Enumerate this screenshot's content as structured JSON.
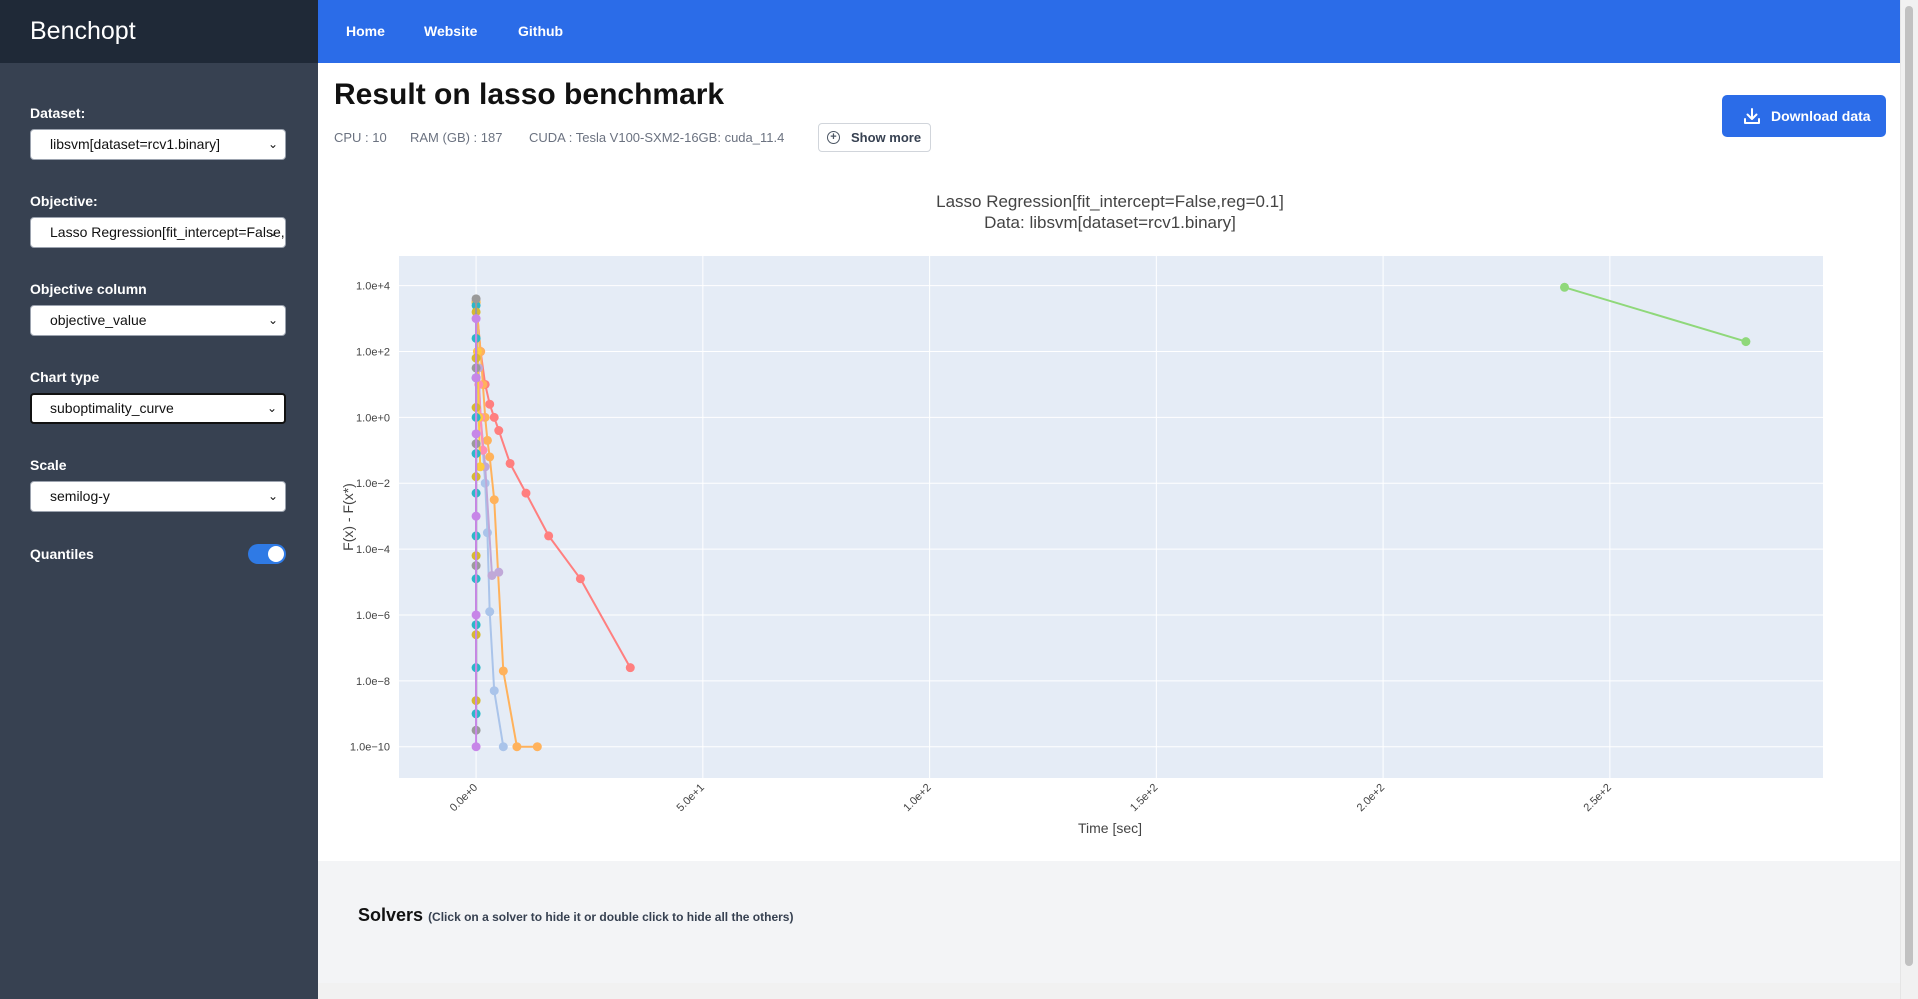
{
  "app": {
    "title": "Benchopt"
  },
  "nav": {
    "home": "Home",
    "website": "Website",
    "github": "Github"
  },
  "sidebar": {
    "dataset": {
      "label": "Dataset:",
      "value": "libsvm[dataset=rcv1.binary]"
    },
    "objective": {
      "label": "Objective:",
      "value": "Lasso Regression[fit_intercept=False,reg=0.1]"
    },
    "objective_column": {
      "label": "Objective column",
      "value": "objective_value"
    },
    "chart_type": {
      "label": "Chart type",
      "value": "suboptimality_curve"
    },
    "scale": {
      "label": "Scale",
      "value": "semilog-y"
    },
    "quantiles": {
      "label": "Quantiles",
      "enabled": true
    }
  },
  "header": {
    "title": "Result on lasso benchmark",
    "cpu": "CPU : 10",
    "ram": "RAM (GB) : 187",
    "cuda": "CUDA : Tesla V100-SXM2-16GB: cuda_11.4",
    "show_more": "Show more",
    "download": "Download data"
  },
  "solvers": {
    "title": "Solvers",
    "hint": "(Click on a solver to hide it or double click to hide all the others)"
  },
  "colors": {
    "nav": "#2b6ce8",
    "sidebar": "#374151",
    "plot_bg": "#e5ecf6"
  },
  "chart_data": {
    "type": "line",
    "title": "Lasso Regression[fit_intercept=False,reg=0.1]",
    "subtitle": "Data: libsvm[dataset=rcv1.binary]",
    "xlabel": "Time [sec]",
    "ylabel": "F(x) - F(x*)",
    "yscale": "log",
    "xlim": [
      -17,
      297
    ],
    "ylim_log10": [
      -10.95,
      4.9
    ],
    "x_ticks": [
      0,
      50,
      100,
      150,
      200,
      250
    ],
    "x_tick_labels": [
      "0.0e+0",
      "5.0e+1",
      "1.0e+2",
      "1.5e+2",
      "2.0e+2",
      "2.5e+2"
    ],
    "y_ticks_log10": [
      4,
      2,
      0,
      -2,
      -4,
      -6,
      -8,
      -10
    ],
    "y_tick_labels": [
      "1.0e+4",
      "1.0e+2",
      "1.0e+0",
      "1.0e−2",
      "1.0e−4",
      "1.0e−6",
      "1.0e−8",
      "1.0e−10"
    ],
    "grid": true,
    "series": [
      {
        "color": "#ff7f7f",
        "x": [
          0,
          1,
          2,
          3,
          4,
          5,
          7.5,
          11,
          16,
          23,
          34
        ],
        "log10_y": [
          3.5,
          2,
          1,
          0.4,
          0,
          -0.4,
          -1.4,
          -2.3,
          -3.6,
          -4.9,
          -7.6
        ]
      },
      {
        "color": "#ffb25c",
        "x": [
          0,
          1,
          1.5,
          2,
          2.5,
          3,
          4,
          6,
          9,
          13.5
        ],
        "log10_y": [
          3.5,
          2,
          1,
          0,
          -0.7,
          -1.2,
          -2.5,
          -7.7,
          -10,
          -10
        ]
      },
      {
        "color": "#aac4ea",
        "x": [
          0,
          0.5,
          1,
          1.5,
          2,
          2.5,
          3,
          4,
          6
        ],
        "log10_y": [
          3.5,
          1.5,
          0,
          -1,
          -2,
          -3.5,
          -5.9,
          -8.3,
          -10
        ]
      },
      {
        "color": "#c0a8d8",
        "x": [
          0,
          0.5,
          1,
          2,
          3.5,
          5
        ],
        "log10_y": [
          3.5,
          1.5,
          0,
          -1.5,
          -4.8,
          -4.7
        ]
      },
      {
        "color": "#ff8fb4",
        "x": [
          0,
          0.3,
          0.6,
          1,
          1.5
        ],
        "log10_y": [
          3.5,
          2,
          1,
          0,
          -1
        ]
      },
      {
        "color": "#ffcb40",
        "x": [
          0,
          0.3,
          0.6,
          0.9
        ],
        "log10_y": [
          3.5,
          2,
          0,
          -1.5
        ]
      },
      {
        "color": "#2bb7c9",
        "x": [
          0,
          0,
          0,
          0,
          0,
          0,
          0,
          0,
          0,
          0,
          0
        ],
        "log10_y": [
          3.4,
          2.4,
          1.2,
          0,
          -1.1,
          -2.3,
          -3.6,
          -4.9,
          -6.3,
          -7.6,
          -9
        ]
      },
      {
        "color": "#d6b832",
        "x": [
          0,
          0,
          0,
          0,
          0,
          0,
          0
        ],
        "log10_y": [
          3.2,
          1.8,
          0.3,
          -1.8,
          -4.2,
          -6.6,
          -8.6
        ]
      },
      {
        "color": "#9a9a9a",
        "x": [
          0,
          0,
          0,
          0,
          0
        ],
        "log10_y": [
          3.6,
          1.5,
          -0.8,
          -4.5,
          -9.5
        ]
      },
      {
        "color": "#c786e8",
        "x": [
          0,
          0,
          0,
          0,
          0,
          0
        ],
        "log10_y": [
          3,
          1.2,
          -0.5,
          -3,
          -6,
          -10
        ]
      },
      {
        "color": "#8fd87a",
        "x": [
          240,
          280
        ],
        "log10_y": [
          3.95,
          2.3
        ]
      }
    ]
  }
}
